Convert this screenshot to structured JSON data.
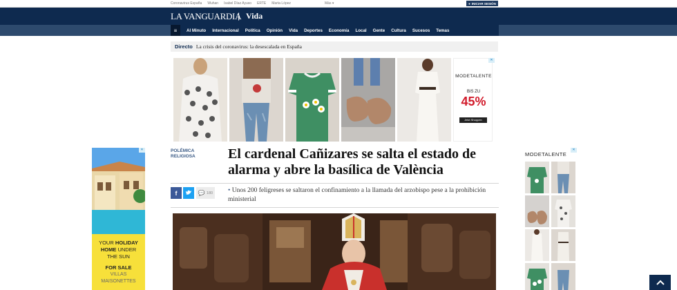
{
  "topbar": {
    "links": [
      "Coronavirus España",
      "Wuhan",
      "Isabel Díaz Ayuso",
      "ERTE",
      "Marta López"
    ],
    "more_label": "Más",
    "login_label": "INICIAR SESIÓN"
  },
  "masthead": {
    "logo": "LA VANGUARDIA",
    "separator": "|",
    "section": "Vida"
  },
  "nav": {
    "items": [
      "Al Minuto",
      "Internacional",
      "Política",
      "Opinión",
      "Vida",
      "Deportes",
      "Economía",
      "Local",
      "Gente",
      "Cultura",
      "Sucesos",
      "Temas"
    ]
  },
  "directo": {
    "tag": "Directo",
    "text": "La crisis del coronavirus: la desescalada en España"
  },
  "ad_top": {
    "brand": "MODETALENTE",
    "bis_zu": "BIS ZU",
    "percent": "45%",
    "cta": "Jetzt Shoppen"
  },
  "article": {
    "kicker_line1": "POLÉMICA",
    "kicker_line2": "RELIGIOSA",
    "headline_line1": "El cardenal Cañizares se salta el estado de",
    "headline_line2": "alarma y abre la basílica de València",
    "comment_count": "180",
    "subtitle": "Unos 200 feligreses se saltaron el confinamiento a la llamada del arzobispo pese a la prohibición ministerial"
  },
  "left_ad": {
    "line1_a": "YOUR ",
    "line1_b": "HOLIDAY",
    "line2_a": "HOME",
    "line2_b": " UNDER",
    "line3": "THE SUN",
    "forsale": "FOR SALE",
    "villas": "VILLAS",
    "maisonettes": "MAISONETTES"
  },
  "right_ad": {
    "brand": "MODETALENTE"
  },
  "colors": {
    "navy": "#0e2a4f",
    "nav_outer": "#2d4a6d",
    "ad_red": "#d11a2a",
    "ad_yellow": "#f7e03a"
  }
}
